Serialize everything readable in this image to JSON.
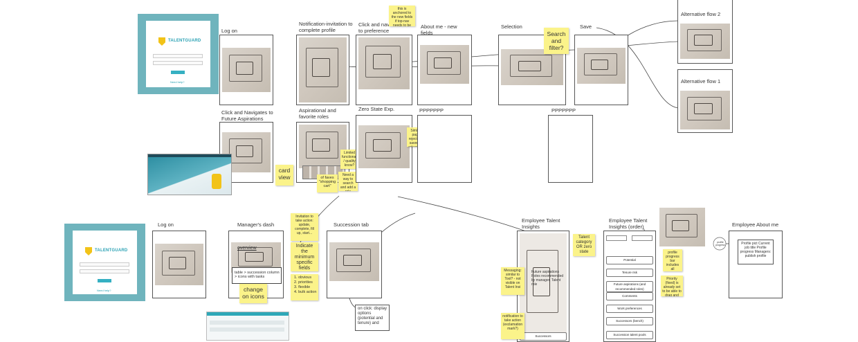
{
  "board": {
    "top_row": {
      "log_on": "Log on",
      "notification": "Notification-invitation to complete profile",
      "click_nav_pref": "Click and nav to preference",
      "about_me": "About me - new fields",
      "selection": "Selection",
      "save": "Save",
      "alt_flow_2": "Alternative flow 2",
      "alt_flow_1": "Alternative flow 1"
    },
    "mid_row": {
      "click_navigates": "Click and Navigates to Future Aspirations",
      "aspirational": "Aspirational and favorite roles",
      "zero_state": "Zero State Exp.",
      "pppp_1": "PPPPPPP",
      "pppp_2": "PPPPPPP"
    },
    "bottom_row": {
      "log_on": "Log on",
      "managers_dash": "Manager's dash",
      "succession_tab": "Succession tab",
      "emp_insights": "Employee Talent Insights",
      "emp_insights_order": "Employee Talent Insights (order)",
      "emp_about": "Employee About me"
    },
    "login_app": {
      "brand": "TALENTGUARD",
      "forgot": "Need help?"
    },
    "stickies": {
      "anchored": "this is anchored to the new fields if top-nav needs to be fixed",
      "search_filter": "Search and filter?",
      "card_view": "card view",
      "zero_note": "Similar page rejected / saved in advanced search",
      "limited": "Limited functionality / quality know?",
      "shopping_cart": "of faves \"shopping cart\"",
      "need_way": "Need a way to search and add a role",
      "invitation": "Invitation to take action: update, complete, fill up, start...",
      "indicate_min": "Indicate the minimum specific fields",
      "change_icons": "change on icons",
      "talent_category": "Talent category OR zero state",
      "messaging": "Messaging: similar to Tool? - not visible on Talent Insi",
      "notification_action": "notification to take action (exclamation mark?)",
      "profile_progress": "profile progress bar includes all categories",
      "priority_note": "Priority (fixed) is already set to be able to drag and assign things"
    },
    "manager_dash": {
      "overview": "overview",
      "table_note": "table > succession column > icons with tasks",
      "list": [
        "1. obvious",
        "2. priorities",
        "3. flexible",
        "4. bulk action"
      ]
    },
    "succession_note": "on click: display options (potential and tenure) and",
    "insights_items": {
      "future_aspirations": "Future aspirations Roles recommended by manager, Talent role",
      "successors": "Successors"
    },
    "order_items": [
      "Potential",
      "Tenure risk",
      "Future aspirations (and recommended roles)",
      "Comments",
      "Work preferences",
      "Successors (bench)",
      "Succession talent pools"
    ],
    "about_me_card": "Profile pict Current job title Profile progress Managers: publish profile",
    "bubble": "profile progress"
  }
}
